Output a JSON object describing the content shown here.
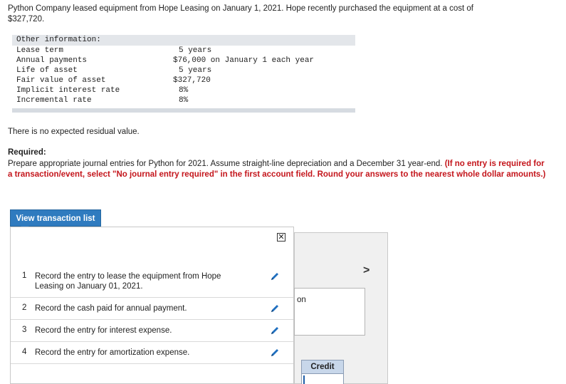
{
  "intro": {
    "line1": "Python Company leased equipment from Hope Leasing on January 1, 2021. Hope recently purchased the equipment at a cost of",
    "line2": "$327,720."
  },
  "other_info": {
    "header": "Other information:",
    "rows": [
      {
        "label": "Lease term",
        "value": "5 years"
      },
      {
        "label": "Annual payments",
        "value": "$76,000 on January 1 each year"
      },
      {
        "label": "Life of asset",
        "value": "5 years"
      },
      {
        "label": "Fair value of asset",
        "value": "$327,720"
      },
      {
        "label": "Implicit interest rate",
        "value": "8%"
      },
      {
        "label": "Incremental rate",
        "value": "8%"
      }
    ]
  },
  "residual_text": "There is no expected residual value.",
  "required": {
    "title": "Required:",
    "text": "Prepare appropriate journal entries for Python for 2021. Assume straight-line depreciation and a December 31 year-end. ",
    "instruction": "(If no entry is required for a transaction/event, select \"No journal entry required\" in the first account field. Round your answers to the nearest whole dollar amounts.)"
  },
  "view_transaction_button": "View transaction list",
  "close_symbol": "✕",
  "transactions": [
    {
      "num": "1",
      "text": "Record the entry to lease the equipment from Hope Leasing on January 01, 2021."
    },
    {
      "num": "2",
      "text": "Record the cash paid for annual payment."
    },
    {
      "num": "3",
      "text": "Record the entry for interest expense."
    },
    {
      "num": "4",
      "text": "Record the entry for amortization expense."
    }
  ],
  "background": {
    "chevron": ">",
    "partial_text": "on",
    "credit_header": "Credit"
  },
  "colors": {
    "accent_blue": "#2f7bbf",
    "instruction_red": "#c4161c",
    "pencil_blue": "#1f6fbf"
  },
  "icons": {
    "edit": "pencil-icon",
    "close": "close-icon",
    "next": "chevron-right-icon"
  }
}
